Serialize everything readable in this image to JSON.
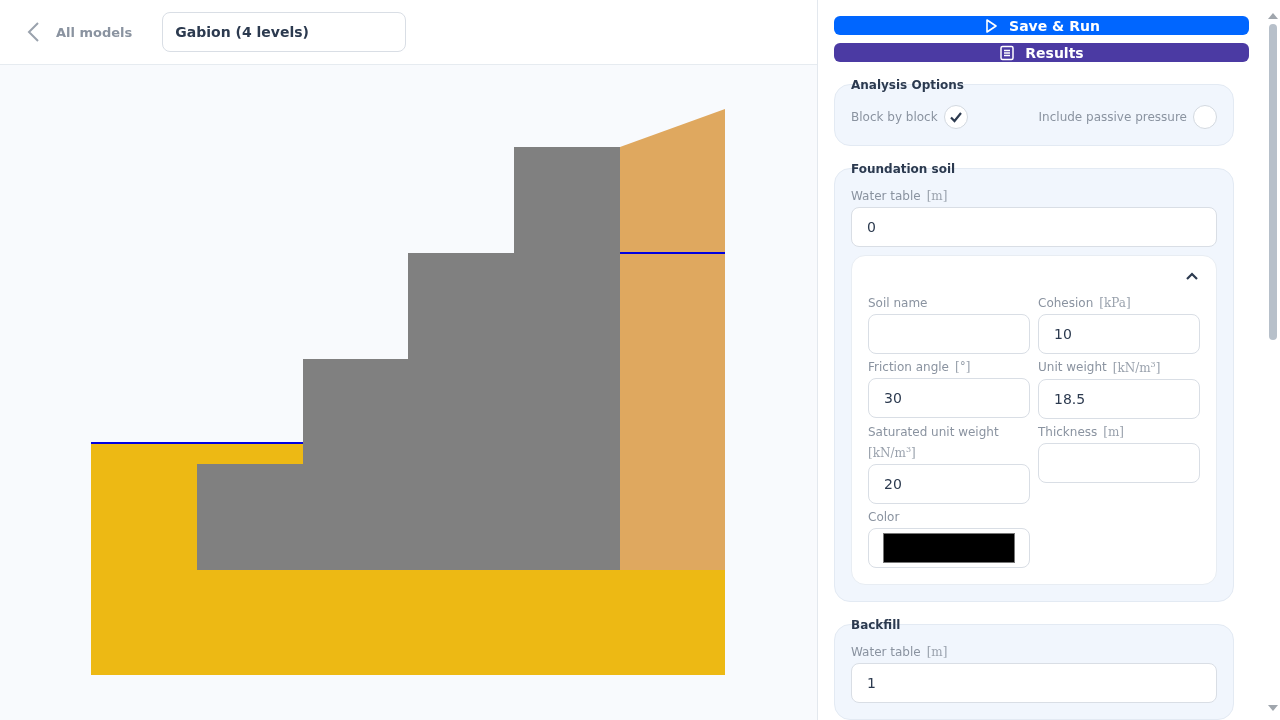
{
  "header": {
    "back_link": "All models",
    "model_name": "Gabion (4 levels)"
  },
  "actions": [
    {
      "kind": "run",
      "label": "Save & Run"
    },
    {
      "kind": "results",
      "label": "Results"
    }
  ],
  "analysis_options": {
    "title": "Analysis Options",
    "options": [
      {
        "label": "Block by block",
        "checked": true
      },
      {
        "label": "Include passive pressure",
        "checked": false
      }
    ]
  },
  "foundation_soil": {
    "title": "Foundation soil",
    "water_table": {
      "label": "Water table",
      "unit": "[m]",
      "value": "0"
    },
    "soil": {
      "expanded": true,
      "fields": [
        {
          "kind": "text",
          "label": "Soil name"
        },
        {
          "kind": "text",
          "label": "Cohesion",
          "unit": "[kPa]",
          "value": "10"
        },
        {
          "kind": "text",
          "label": "Friction angle",
          "unit": "[°]",
          "value": "30"
        },
        {
          "kind": "text",
          "label": "Unit weight",
          "unit": "[kN/m$^{3}$]",
          "value": "18.5"
        },
        {
          "kind": "text",
          "label": "Saturated unit weight",
          "unit": "[kN/m$^{3}$]",
          "value": "20"
        },
        {
          "kind": "text",
          "label": "Thickness",
          "unit": "[m]"
        },
        {
          "kind": "color",
          "label": "Color",
          "color": "#000000"
        }
      ]
    }
  },
  "backfill": {
    "title": "Backfill",
    "water_table": {
      "label": "Water table",
      "unit": "[m]",
      "value": "1"
    }
  }
}
